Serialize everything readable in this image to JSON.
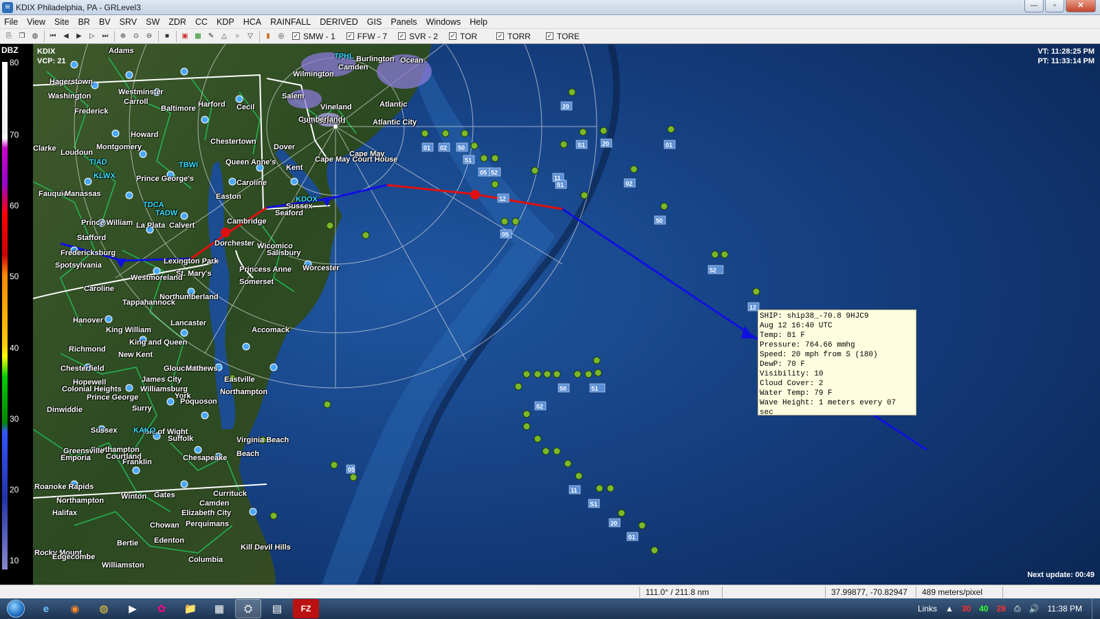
{
  "window": {
    "title": "KDIX Philadelphia, PA - GRLevel3",
    "minimize": "—",
    "maximize": "▫",
    "close": "✕"
  },
  "menu": [
    "File",
    "View",
    "Site",
    "BR",
    "BV",
    "SRV",
    "SW",
    "ZDR",
    "CC",
    "KDP",
    "HCA",
    "RAINFALL",
    "DERIVED",
    "GIS",
    "Panels",
    "Windows",
    "Help"
  ],
  "toolbar": {
    "warnings": [
      {
        "label": "SMW - 1",
        "checked": true
      },
      {
        "label": "FFW - 7",
        "checked": true
      },
      {
        "label": "SVR - 2",
        "checked": true
      },
      {
        "label": "TOR",
        "checked": true
      },
      {
        "label": "TORR",
        "checked": true
      },
      {
        "label": "TORE",
        "checked": true
      }
    ]
  },
  "legend": {
    "product": "DBZ",
    "ticks": [
      "80",
      "70",
      "60",
      "50",
      "40",
      "30",
      "20",
      "10"
    ]
  },
  "map": {
    "radar_id": "KDIX",
    "vcp": "VCP: 21",
    "vt": "VT: 11:28:25 PM",
    "pt": "PT: 11:33:14 PM",
    "next_update": "Next update: 00:49",
    "places": [
      "Adams",
      "Hagerstown",
      "Washington",
      "Frederick",
      "Westminster",
      "Carroll",
      "Baltimore",
      "Harford",
      "Cecil",
      "Salem",
      "Cumberland",
      "Atlantic",
      "Atlantic City",
      "Chestertown",
      "Queen Anne's",
      "Kent",
      "Caroline",
      "Cape May",
      "Cape May Court House",
      "KDOX",
      "Sussex",
      "Dorchester",
      "Wicomico",
      "Salisbury",
      "Worcester",
      "Princess Anne",
      "Somerset",
      "Lexington Park",
      "St. Mary's",
      "Calvert",
      "La Plata",
      "Prince William",
      "Stafford",
      "Fredericksburg",
      "Spotsylvania",
      "Caroline",
      "Westmoreland",
      "Tappahannock",
      "Northumberland",
      "Hanover",
      "King William",
      "King and Queen",
      "Lancaster",
      "Richmond",
      "New Kent",
      "Gloucester",
      "Mathews",
      "Accomack",
      "Eastville",
      "Northampton",
      "Chesterfield",
      "Hopewell",
      "Colonial Heights",
      "Prince George",
      "Williamsburg",
      "James City",
      "York",
      "Poquoson",
      "Dinwiddie",
      "Surry",
      "Sussex",
      "Isle of Wight",
      "Suffolk",
      "Southampton",
      "Courtland",
      "Franklin",
      "Emporia",
      "Greensville",
      "Virginia Beach",
      "Beach",
      "Chesapeake",
      "Roanoke Rapids",
      "Northampton",
      "Halifax",
      "Winton",
      "Gates",
      "Currituck",
      "Camden",
      "Elizabeth City",
      "Perquimans",
      "Chowan",
      "Bertie",
      "Edenton",
      "Kill Devil Hills",
      "Columbia",
      "Williamston",
      "Rocky Mount",
      "Edgecombe",
      "KLWX",
      "TIAD",
      "TDCA",
      "TADW",
      "KAKO",
      "TPHL",
      "TBWI",
      "Fauquier",
      "Manassas",
      "Clarke",
      "Loudoun",
      "Howard",
      "Montgomery",
      "Prince George's",
      "Easton",
      "Cambridge",
      "Seaford",
      "Dover",
      "Vineland",
      "Wilmington",
      "Camden",
      "Burlington",
      "Ocean",
      "Cumberland"
    ],
    "station_ids": [
      "20",
      "01",
      "02",
      "50",
      "51",
      "05",
      "52",
      "12",
      "11",
      "S1"
    ]
  },
  "popup": {
    "lines": [
      "SHIP: ship38_-70.8 9HJC9",
      "Aug 12 16:40 UTC",
      "Temp: 81 F",
      "Pressure: 764.66 mmhg",
      "Speed: 20 mph from S (180)",
      "DewP: 70 F",
      "Visibility: 10",
      "Cloud Cover: 2",
      "Water Temp: 79 F",
      "Wave Height: 1 meters every 07",
      "sec"
    ]
  },
  "status": {
    "range": "111.0° / 211.8 nm",
    "coords": "37.99877, -70.82947",
    "scale": "489 meters/pixel"
  },
  "taskbar": {
    "apps": [
      "e",
      "◉",
      "◍",
      "▶",
      "✿",
      "📁",
      "▦",
      "⛭",
      "▤",
      "FZ"
    ],
    "links": "Links",
    "tray_nums": [
      "30",
      "40",
      "28"
    ],
    "time": "11:38 PM"
  },
  "colors": {
    "ocean": "#0b2a55",
    "land": "#2f4a23",
    "county": "#22c35a",
    "state": "#ffffff",
    "front_cold": "#1010e0",
    "front_warm": "#e01010",
    "popup_bg": "#fffde0"
  }
}
